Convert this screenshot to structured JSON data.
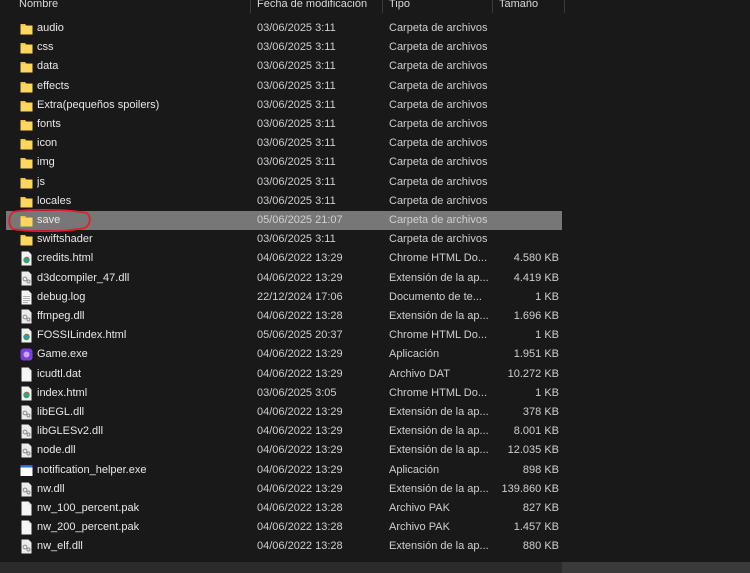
{
  "columns": {
    "name": "Nombre",
    "date": "Fecha de modificación",
    "type": "Tipo",
    "size": "Tamaño"
  },
  "selected_index": 10,
  "files": [
    {
      "name": "audio",
      "date": "03/06/2025 3:11",
      "type": "Carpeta de archivos",
      "size": "",
      "icon": "folder-icon"
    },
    {
      "name": "css",
      "date": "03/06/2025 3:11",
      "type": "Carpeta de archivos",
      "size": "",
      "icon": "folder-icon"
    },
    {
      "name": "data",
      "date": "03/06/2025 3:11",
      "type": "Carpeta de archivos",
      "size": "",
      "icon": "folder-icon"
    },
    {
      "name": "effects",
      "date": "03/06/2025 3:11",
      "type": "Carpeta de archivos",
      "size": "",
      "icon": "folder-icon"
    },
    {
      "name": "Extra(pequeños spoilers)",
      "date": "03/06/2025 3:11",
      "type": "Carpeta de archivos",
      "size": "",
      "icon": "folder-icon"
    },
    {
      "name": "fonts",
      "date": "03/06/2025 3:11",
      "type": "Carpeta de archivos",
      "size": "",
      "icon": "folder-icon"
    },
    {
      "name": "icon",
      "date": "03/06/2025 3:11",
      "type": "Carpeta de archivos",
      "size": "",
      "icon": "folder-icon"
    },
    {
      "name": "img",
      "date": "03/06/2025 3:11",
      "type": "Carpeta de archivos",
      "size": "",
      "icon": "folder-icon"
    },
    {
      "name": "js",
      "date": "03/06/2025 3:11",
      "type": "Carpeta de archivos",
      "size": "",
      "icon": "folder-icon"
    },
    {
      "name": "locales",
      "date": "03/06/2025 3:11",
      "type": "Carpeta de archivos",
      "size": "",
      "icon": "folder-icon"
    },
    {
      "name": "save",
      "date": "05/06/2025 21:07",
      "type": "Carpeta de archivos",
      "size": "",
      "icon": "folder-icon"
    },
    {
      "name": "swiftshader",
      "date": "03/06/2025 3:11",
      "type": "Carpeta de archivos",
      "size": "",
      "icon": "folder-icon"
    },
    {
      "name": "credits.html",
      "date": "04/06/2022 13:29",
      "type": "Chrome HTML Do...",
      "size": "4.580 KB",
      "icon": "chrome-html-icon"
    },
    {
      "name": "d3dcompiler_47.dll",
      "date": "04/06/2022 13:29",
      "type": "Extensión de la ap...",
      "size": "4.419 KB",
      "icon": "dll-icon"
    },
    {
      "name": "debug.log",
      "date": "22/12/2024 17:06",
      "type": "Documento de te...",
      "size": "1 KB",
      "icon": "text-file-icon"
    },
    {
      "name": "ffmpeg.dll",
      "date": "04/06/2022 13:28",
      "type": "Extensión de la ap...",
      "size": "1.696 KB",
      "icon": "dll-icon"
    },
    {
      "name": "FOSSILindex.html",
      "date": "05/06/2025 20:37",
      "type": "Chrome HTML Do...",
      "size": "1 KB",
      "icon": "chrome-html-icon"
    },
    {
      "name": "Game.exe",
      "date": "04/06/2022 13:29",
      "type": "Aplicación",
      "size": "1.951 KB",
      "icon": "game-exe-icon"
    },
    {
      "name": "icudtl.dat",
      "date": "04/06/2022 13:29",
      "type": "Archivo DAT",
      "size": "10.272 KB",
      "icon": "generic-file-icon"
    },
    {
      "name": "index.html",
      "date": "03/06/2025 3:05",
      "type": "Chrome HTML Do...",
      "size": "1 KB",
      "icon": "chrome-html-icon"
    },
    {
      "name": "libEGL.dll",
      "date": "04/06/2022 13:29",
      "type": "Extensión de la ap...",
      "size": "378 KB",
      "icon": "dll-icon"
    },
    {
      "name": "libGLESv2.dll",
      "date": "04/06/2022 13:29",
      "type": "Extensión de la ap...",
      "size": "8.001 KB",
      "icon": "dll-icon"
    },
    {
      "name": "node.dll",
      "date": "04/06/2022 13:29",
      "type": "Extensión de la ap...",
      "size": "12.035 KB",
      "icon": "dll-icon"
    },
    {
      "name": "notification_helper.exe",
      "date": "04/06/2022 13:29",
      "type": "Aplicación",
      "size": "898 KB",
      "icon": "exe-icon"
    },
    {
      "name": "nw.dll",
      "date": "04/06/2022 13:29",
      "type": "Extensión de la ap...",
      "size": "139.860 KB",
      "icon": "dll-icon"
    },
    {
      "name": "nw_100_percent.pak",
      "date": "04/06/2022 13:28",
      "type": "Archivo PAK",
      "size": "827 KB",
      "icon": "generic-file-icon"
    },
    {
      "name": "nw_200_percent.pak",
      "date": "04/06/2022 13:28",
      "type": "Archivo PAK",
      "size": "1.457 KB",
      "icon": "generic-file-icon"
    },
    {
      "name": "nw_elf.dll",
      "date": "04/06/2022 13:28",
      "type": "Extensión de la ap...",
      "size": "880 KB",
      "icon": "dll-icon"
    }
  ],
  "colors": {
    "background": "#191919",
    "selected": "#777777",
    "folder": "#f5c542",
    "annotation": "#e0202a"
  }
}
